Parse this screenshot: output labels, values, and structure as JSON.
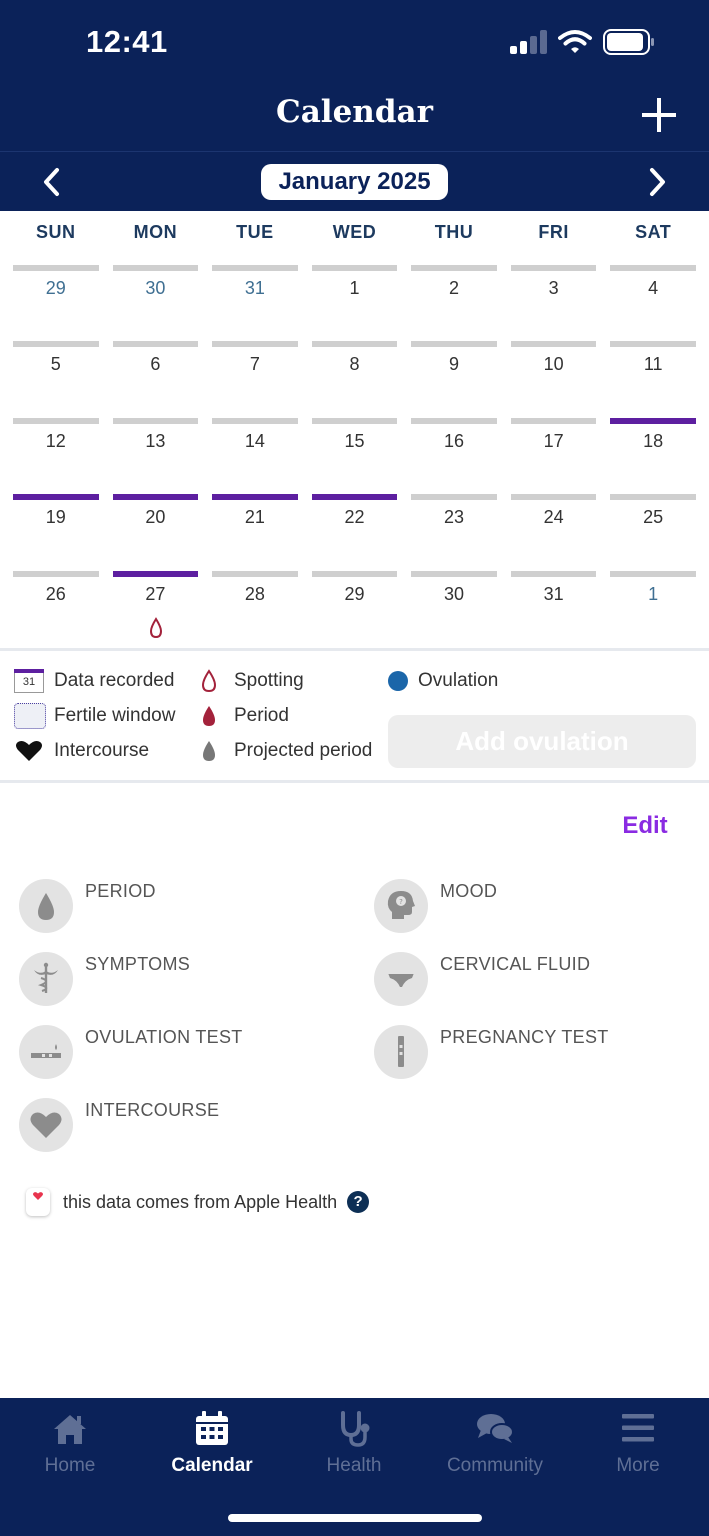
{
  "status_bar": {
    "time": "12:41"
  },
  "header": {
    "title": "Calendar",
    "month": "January 2025"
  },
  "weekdays": [
    "SUN",
    "MON",
    "TUE",
    "WED",
    "THU",
    "FRI",
    "SAT"
  ],
  "calendar": {
    "weeks": [
      [
        {
          "d": "29",
          "other": true,
          "rec": false
        },
        {
          "d": "30",
          "other": true,
          "rec": false
        },
        {
          "d": "31",
          "other": true,
          "rec": false
        },
        {
          "d": "1",
          "other": false,
          "rec": false
        },
        {
          "d": "2",
          "other": false,
          "rec": false
        },
        {
          "d": "3",
          "other": false,
          "rec": false
        },
        {
          "d": "4",
          "other": false,
          "rec": false
        }
      ],
      [
        {
          "d": "5",
          "other": false,
          "rec": false
        },
        {
          "d": "6",
          "other": false,
          "rec": false
        },
        {
          "d": "7",
          "other": false,
          "rec": false
        },
        {
          "d": "8",
          "other": false,
          "rec": false
        },
        {
          "d": "9",
          "other": false,
          "rec": false
        },
        {
          "d": "10",
          "other": false,
          "rec": false
        },
        {
          "d": "11",
          "other": false,
          "rec": false
        }
      ],
      [
        {
          "d": "12",
          "other": false,
          "rec": false
        },
        {
          "d": "13",
          "other": false,
          "rec": false
        },
        {
          "d": "14",
          "other": false,
          "rec": false
        },
        {
          "d": "15",
          "other": false,
          "rec": false
        },
        {
          "d": "16",
          "other": false,
          "rec": false
        },
        {
          "d": "17",
          "other": false,
          "rec": false
        },
        {
          "d": "18",
          "other": false,
          "rec": true
        }
      ],
      [
        {
          "d": "19",
          "other": false,
          "rec": true
        },
        {
          "d": "20",
          "other": false,
          "rec": true
        },
        {
          "d": "21",
          "other": false,
          "rec": true
        },
        {
          "d": "22",
          "other": false,
          "rec": true
        },
        {
          "d": "23",
          "other": false,
          "rec": false
        },
        {
          "d": "24",
          "other": false,
          "rec": false
        },
        {
          "d": "25",
          "other": false,
          "rec": false
        }
      ],
      [
        {
          "d": "26",
          "other": false,
          "rec": false
        },
        {
          "d": "27",
          "other": false,
          "rec": true,
          "spotting": true
        },
        {
          "d": "28",
          "other": false,
          "rec": false
        },
        {
          "d": "29",
          "other": false,
          "rec": false
        },
        {
          "d": "30",
          "other": false,
          "rec": false
        },
        {
          "d": "31",
          "other": false,
          "rec": false
        },
        {
          "d": "1",
          "other": true,
          "rec": false
        }
      ]
    ]
  },
  "legend": {
    "mini_cal_number": "31",
    "data_recorded": "Data recorded",
    "fertile_window": "Fertile window",
    "intercourse": "Intercourse",
    "spotting": "Spotting",
    "period": "Period",
    "projected_period": "Projected period",
    "ovulation": "Ovulation",
    "add_ovulation": "Add ovulation"
  },
  "tracking": {
    "edit": "Edit",
    "period": "PERIOD",
    "mood": "MOOD",
    "symptoms": "SYMPTOMS",
    "cervical_fluid": "CERVICAL FLUID",
    "ovulation_test": "OVULATION TEST",
    "pregnancy_test": "PREGNANCY TEST",
    "intercourse": "INTERCOURSE"
  },
  "health_note": {
    "text": "this data comes from Apple Health",
    "help": "?"
  },
  "tabs": {
    "home": "Home",
    "calendar": "Calendar",
    "health": "Health",
    "community": "Community",
    "more": "More"
  },
  "colors": {
    "navy": "#0b2259",
    "recorded_bar": "#5d1fa0",
    "period_red": "#a3223b",
    "ovulation_blue": "#1b66a9",
    "edit_purple": "#8a2be2"
  }
}
